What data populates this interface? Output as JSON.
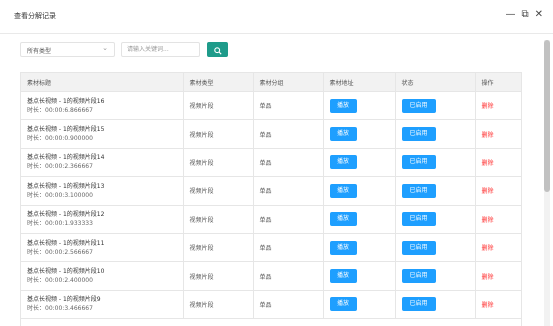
{
  "dialog": {
    "title": "查看分解记录",
    "minimize_icon": "minus-icon",
    "maximize_icon": "maximize-icon",
    "close_icon": "close-icon"
  },
  "toolbar": {
    "type_select": "所有类型",
    "search_placeholder": "请输入关键词...",
    "search_button_icon": "search-icon"
  },
  "table": {
    "columns": [
      "素材标题",
      "素材类型",
      "素材分组",
      "素材地址",
      "状态",
      "操作"
    ],
    "rows": [
      {
        "title": "基点长视频 - 1的视频片段16",
        "duration": "时长：00:00:6.866667",
        "type": "视频片段",
        "group": "单品",
        "play": "播放",
        "status": "已启用",
        "action": "删除"
      },
      {
        "title": "基点长视频 - 1的视频片段15",
        "duration": "时长：00:00:0.900000",
        "type": "视频片段",
        "group": "单品",
        "play": "播放",
        "status": "已启用",
        "action": "删除"
      },
      {
        "title": "基点长视频 - 1的视频片段14",
        "duration": "时长：00:00:2.366667",
        "type": "视频片段",
        "group": "单品",
        "play": "播放",
        "status": "已启用",
        "action": "删除"
      },
      {
        "title": "基点长视频 - 1的视频片段13",
        "duration": "时长：00:00:3.100000",
        "type": "视频片段",
        "group": "单品",
        "play": "播放",
        "status": "已启用",
        "action": "删除"
      },
      {
        "title": "基点长视频 - 1的视频片段12",
        "duration": "时长：00:00:1.933333",
        "type": "视频片段",
        "group": "单品",
        "play": "播放",
        "status": "已启用",
        "action": "删除"
      },
      {
        "title": "基点长视频 - 1的视频片段11",
        "duration": "时长：00:00:2.566667",
        "type": "视频片段",
        "group": "单品",
        "play": "播放",
        "status": "已启用",
        "action": "删除"
      },
      {
        "title": "基点长视频 - 1的视频片段10",
        "duration": "时长：00:00:2.400000",
        "type": "视频片段",
        "group": "单品",
        "play": "播放",
        "status": "已启用",
        "action": "删除"
      },
      {
        "title": "基点长视频 - 1的视频片段9",
        "duration": "时长：00:00:3.466667",
        "type": "视频片段",
        "group": "单品",
        "play": "播放",
        "status": "已启用",
        "action": "删除"
      }
    ]
  }
}
